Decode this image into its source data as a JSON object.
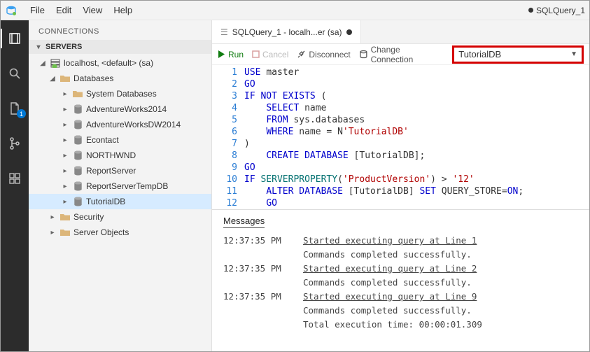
{
  "menubar": {
    "items": [
      "File",
      "Edit",
      "View",
      "Help"
    ],
    "right_label": "SQLQuery_1"
  },
  "activitybar": {
    "explorer_badge": "1"
  },
  "sidebar": {
    "title": "CONNECTIONS",
    "section": "SERVERS",
    "server_label": "localhost, <default> (sa)",
    "databases_label": "Databases",
    "db_list": [
      "System Databases",
      "AdventureWorks2014",
      "AdventureWorksDW2014",
      "Econtact",
      "NORTHWND",
      "ReportServer",
      "ReportServerTempDB",
      "TutorialDB"
    ],
    "security_label": "Security",
    "server_objects_label": "Server Objects"
  },
  "tab": {
    "label": "SQLQuery_1 - localh...er (sa)"
  },
  "toolbar": {
    "run": "Run",
    "cancel": "Cancel",
    "disconnect": "Disconnect",
    "change_conn": "Change Connection",
    "database": "TutorialDB"
  },
  "code": {
    "lines": [
      {
        "n": "1",
        "seg": [
          [
            "kw",
            "USE"
          ],
          [
            "",
            ""
          ],
          [
            "",
            "master"
          ]
        ]
      },
      {
        "n": "2",
        "seg": [
          [
            "kw",
            "GO"
          ]
        ]
      },
      {
        "n": "3",
        "seg": [
          [
            "kw",
            "IF"
          ],
          [
            "",
            " "
          ],
          [
            "kw",
            "NOT"
          ],
          [
            "",
            " "
          ],
          [
            "kw",
            "EXISTS"
          ],
          [
            "",
            " "
          ],
          [
            "",
            "("
          ]
        ]
      },
      {
        "n": "4",
        "seg": [
          [
            "",
            "    "
          ],
          [
            "kw",
            "SELECT"
          ],
          [
            "",
            " name"
          ]
        ]
      },
      {
        "n": "5",
        "seg": [
          [
            "",
            "    "
          ],
          [
            "kw",
            "FROM"
          ],
          [
            "",
            " sys"
          ],
          [
            "",
            ".databases"
          ]
        ]
      },
      {
        "n": "6",
        "seg": [
          [
            "",
            "    "
          ],
          [
            "kw",
            "WHERE"
          ],
          [
            "",
            " name "
          ],
          [
            "",
            "="
          ],
          [
            "",
            " N"
          ],
          [
            "str",
            "'TutorialDB'"
          ]
        ]
      },
      {
        "n": "7",
        "seg": [
          [
            "",
            ")"
          ]
        ]
      },
      {
        "n": "8",
        "seg": [
          [
            "",
            "    "
          ],
          [
            "kw",
            "CREATE"
          ],
          [
            "",
            " "
          ],
          [
            "kw",
            "DATABASE"
          ],
          [
            "",
            " [TutorialDB];"
          ]
        ]
      },
      {
        "n": "9",
        "seg": [
          [
            "kw",
            "GO"
          ]
        ]
      },
      {
        "n": "10",
        "seg": [
          [
            "kw",
            "IF"
          ],
          [
            "",
            " "
          ],
          [
            "ident",
            "SERVERPROPERTY"
          ],
          [
            "",
            "("
          ],
          [
            "str",
            "'ProductVersion'"
          ],
          [
            "",
            ") "
          ],
          [
            "",
            ">"
          ],
          [
            "",
            " "
          ],
          [
            "str",
            "'12'"
          ]
        ]
      },
      {
        "n": "11",
        "seg": [
          [
            "",
            "    "
          ],
          [
            "kw",
            "ALTER"
          ],
          [
            "",
            " "
          ],
          [
            "kw",
            "DATABASE"
          ],
          [
            "",
            " [TutorialDB] "
          ],
          [
            "kw",
            "SET"
          ],
          [
            "",
            " QUERY_STORE"
          ],
          [
            "",
            "="
          ],
          [
            "kw",
            "ON"
          ],
          [
            "",
            ";"
          ]
        ]
      },
      {
        "n": "12",
        "seg": [
          [
            "",
            "    "
          ],
          [
            "kw",
            "GO"
          ]
        ]
      }
    ]
  },
  "messages": {
    "title": "Messages",
    "rows": [
      {
        "ts": "12:37:35 PM",
        "text": "Started executing query at Line 1",
        "link": true
      },
      {
        "ts": "",
        "text": "Commands completed successfully.",
        "link": false
      },
      {
        "ts": "12:37:35 PM",
        "text": "Started executing query at Line 2",
        "link": true
      },
      {
        "ts": "",
        "text": "Commands completed successfully.",
        "link": false
      },
      {
        "ts": "12:37:35 PM",
        "text": "Started executing query at Line 9",
        "link": true
      },
      {
        "ts": "",
        "text": "Commands completed successfully.",
        "link": false
      },
      {
        "ts": "",
        "text": "Total execution time: 00:00:01.309",
        "link": false
      }
    ]
  }
}
